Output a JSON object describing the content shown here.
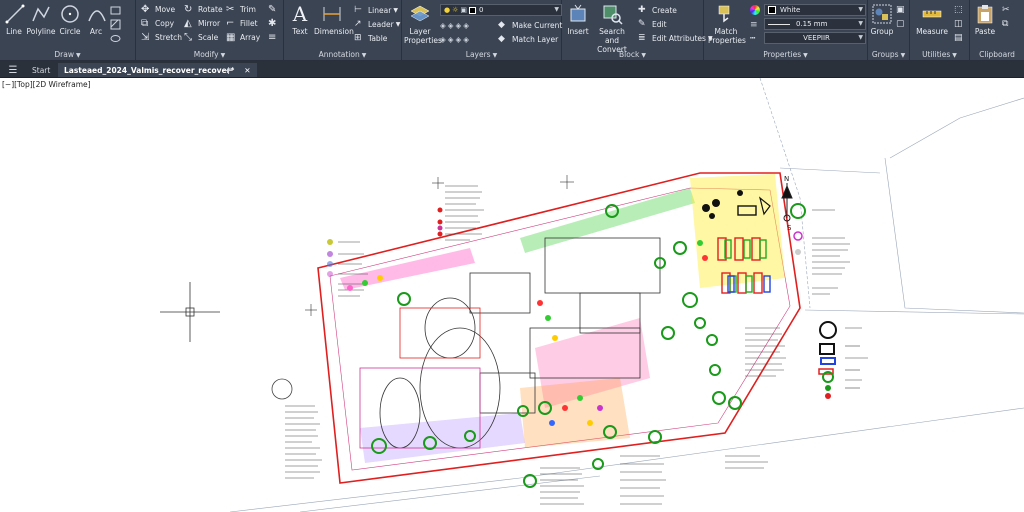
{
  "ribbon": {
    "draw": {
      "title": "Draw",
      "line": "Line",
      "polyline": "Polyline",
      "circle": "Circle",
      "arc": "Arc"
    },
    "modify": {
      "title": "Modify",
      "move": "Move",
      "rotate": "Rotate",
      "trim": "Trim",
      "copy": "Copy",
      "mirror": "Mirror",
      "fillet": "Fillet",
      "stretch": "Stretch",
      "scale": "Scale",
      "array": "Array"
    },
    "annotation": {
      "title": "Annotation",
      "text": "Text",
      "dimension": "Dimension",
      "linear": "Linear",
      "leader": "Leader",
      "table": "Table"
    },
    "layers": {
      "title": "Layers",
      "layer_properties": "Layer Properties",
      "layer_value": "0",
      "make_current": "Make Current",
      "match_layer": "Match Layer"
    },
    "block": {
      "title": "Block",
      "insert": "Insert",
      "search_convert": "Search and Convert",
      "create": "Create",
      "edit": "Edit",
      "edit_attributes": "Edit Attributes"
    },
    "properties": {
      "title": "Properties",
      "match_properties": "Match Properties",
      "color": "White",
      "lineweight": "0.15 mm",
      "linetype": "VEEPIIR"
    },
    "groups": {
      "title": "Groups",
      "group": "Group"
    },
    "utilities": {
      "title": "Utilities",
      "measure": "Measure"
    },
    "clipboard": {
      "title": "Clipboard",
      "paste": "Paste"
    }
  },
  "tabs": {
    "start": "Start",
    "document": "Lasteaed_2024_Valmis_recover_recover*"
  },
  "viewport": {
    "label": "[−][Top][2D Wireframe]"
  },
  "colors": {
    "ribbon_bg": "#3b4453",
    "tab_bg": "#2b313b",
    "canvas_bg": "#ffffff",
    "accent_red": "#e02020",
    "accent_green": "#1a9a1a"
  }
}
